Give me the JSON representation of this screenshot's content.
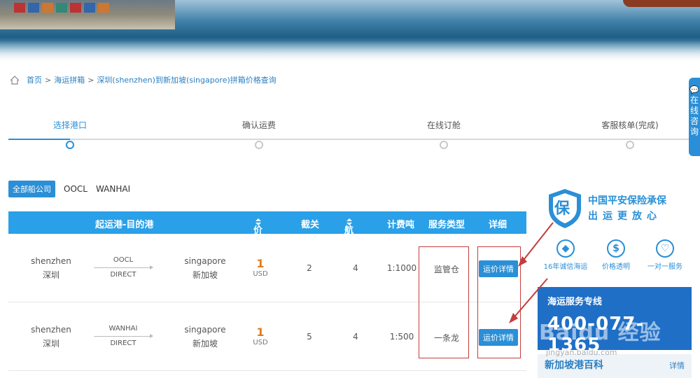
{
  "breadcrumb": {
    "home": "首页",
    "sep": ">",
    "level1": "海运拼箱",
    "current": "深圳(shenzhen)到新加坡(singapore)拼箱价格查询"
  },
  "steps": [
    {
      "label": "选择港口",
      "active": true
    },
    {
      "label": "确认运费",
      "active": false
    },
    {
      "label": "在线订舱",
      "active": false
    },
    {
      "label": "客服核单(完成)",
      "active": false
    }
  ],
  "carriers": {
    "all": "全部船公司",
    "items": [
      "OOCL",
      "WANHAI"
    ]
  },
  "table": {
    "headers": {
      "route": "起运港-目的港",
      "price": "价格",
      "cutoff": "截关",
      "voyage": "航程",
      "ratio": "计费吨",
      "service": "服务类型",
      "detail": "详细"
    },
    "rows": [
      {
        "origin_en": "shenzhen",
        "origin_cn": "深圳",
        "carrier": "OOCL",
        "mode": "DIRECT",
        "dest_en": "singapore",
        "dest_cn": "新加坡",
        "price": "1",
        "currency": "USD",
        "cutoff": "2",
        "voyage": "4",
        "ratio": "1:1000",
        "service": "监管仓",
        "btn": "运价详情"
      },
      {
        "origin_en": "shenzhen",
        "origin_cn": "深圳",
        "carrier": "WANHAI",
        "mode": "DIRECT",
        "dest_en": "singapore",
        "dest_cn": "新加坡",
        "price": "1",
        "currency": "USD",
        "cutoff": "5",
        "voyage": "4",
        "ratio": "1:500",
        "service": "一条龙",
        "btn": "运价详情"
      }
    ]
  },
  "side_tab": {
    "label": "在线咨询"
  },
  "insurance": {
    "badge": "保",
    "line1": "中国平安保险承保",
    "line2": "出运更放心",
    "features": [
      {
        "icon": "diamond-icon",
        "label": "16年诚信海运"
      },
      {
        "icon": "dollar-icon",
        "label": "价格透明"
      },
      {
        "icon": "heart-icon",
        "label": "一对一服务"
      }
    ]
  },
  "hotline": {
    "title": "海运服务专线",
    "number": "400-077-1365"
  },
  "wiki": {
    "title": "新加坡港百科",
    "more": "详情"
  },
  "watermark": {
    "text": "Baidu 经验",
    "url": "jingyan.baidu.com"
  },
  "colors": {
    "accent": "#2a8fd6",
    "header": "#2aa0e8",
    "price": "#e07b1e",
    "annotation": "#c43d3d"
  }
}
